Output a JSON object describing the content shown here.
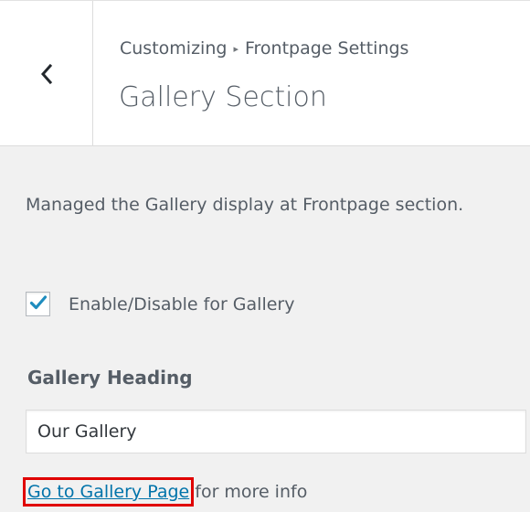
{
  "header": {
    "back_icon": "chevron-left-icon",
    "breadcrumb_root": "Customizing",
    "breadcrumb_separator": "▸",
    "breadcrumb_current": "Frontpage Settings",
    "section_title": "Gallery Section"
  },
  "content": {
    "description": "Managed the Gallery display at Frontpage section.",
    "checkbox": {
      "checked": true,
      "label": "Enable/Disable for Gallery",
      "check_color": "#1e8cbe"
    },
    "heading_field": {
      "label": "Gallery Heading",
      "value": "Our Gallery"
    },
    "link": {
      "text": "Go to Gallery Page",
      "suffix": " for more info",
      "highlight_color": "#e00000"
    }
  }
}
